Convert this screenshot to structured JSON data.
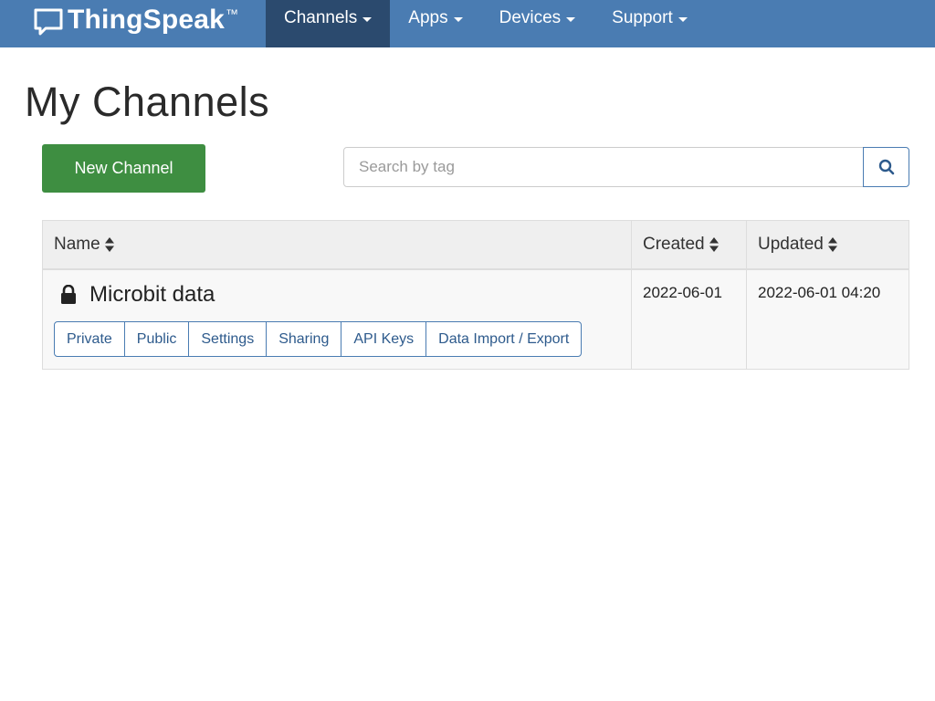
{
  "navbar": {
    "brand": "ThingSpeak",
    "brand_tm": "™",
    "brand_icon": "speech-bubble-icon",
    "items": [
      {
        "label": "Channels",
        "active": true
      },
      {
        "label": "Apps",
        "active": false
      },
      {
        "label": "Devices",
        "active": false
      },
      {
        "label": "Support",
        "active": false
      }
    ]
  },
  "page": {
    "title": "My Channels",
    "new_channel_label": "New Channel"
  },
  "search": {
    "placeholder": "Search by tag",
    "value": "",
    "icon": "search-icon"
  },
  "table": {
    "columns": [
      "Name",
      "Created",
      "Updated"
    ],
    "rows": [
      {
        "name": "Microbit data",
        "icon": "lock-icon",
        "created": "2022-06-01",
        "updated": "2022-06-01 04:20",
        "actions": [
          "Private",
          "Public",
          "Settings",
          "Sharing",
          "API Keys",
          "Data Import / Export"
        ]
      }
    ]
  },
  "colors": {
    "navbar": "#4a7cb2",
    "navbar_active": "#2b4a6e",
    "new_button": "#3e8e41",
    "link_button_border": "#4a7cb2"
  }
}
